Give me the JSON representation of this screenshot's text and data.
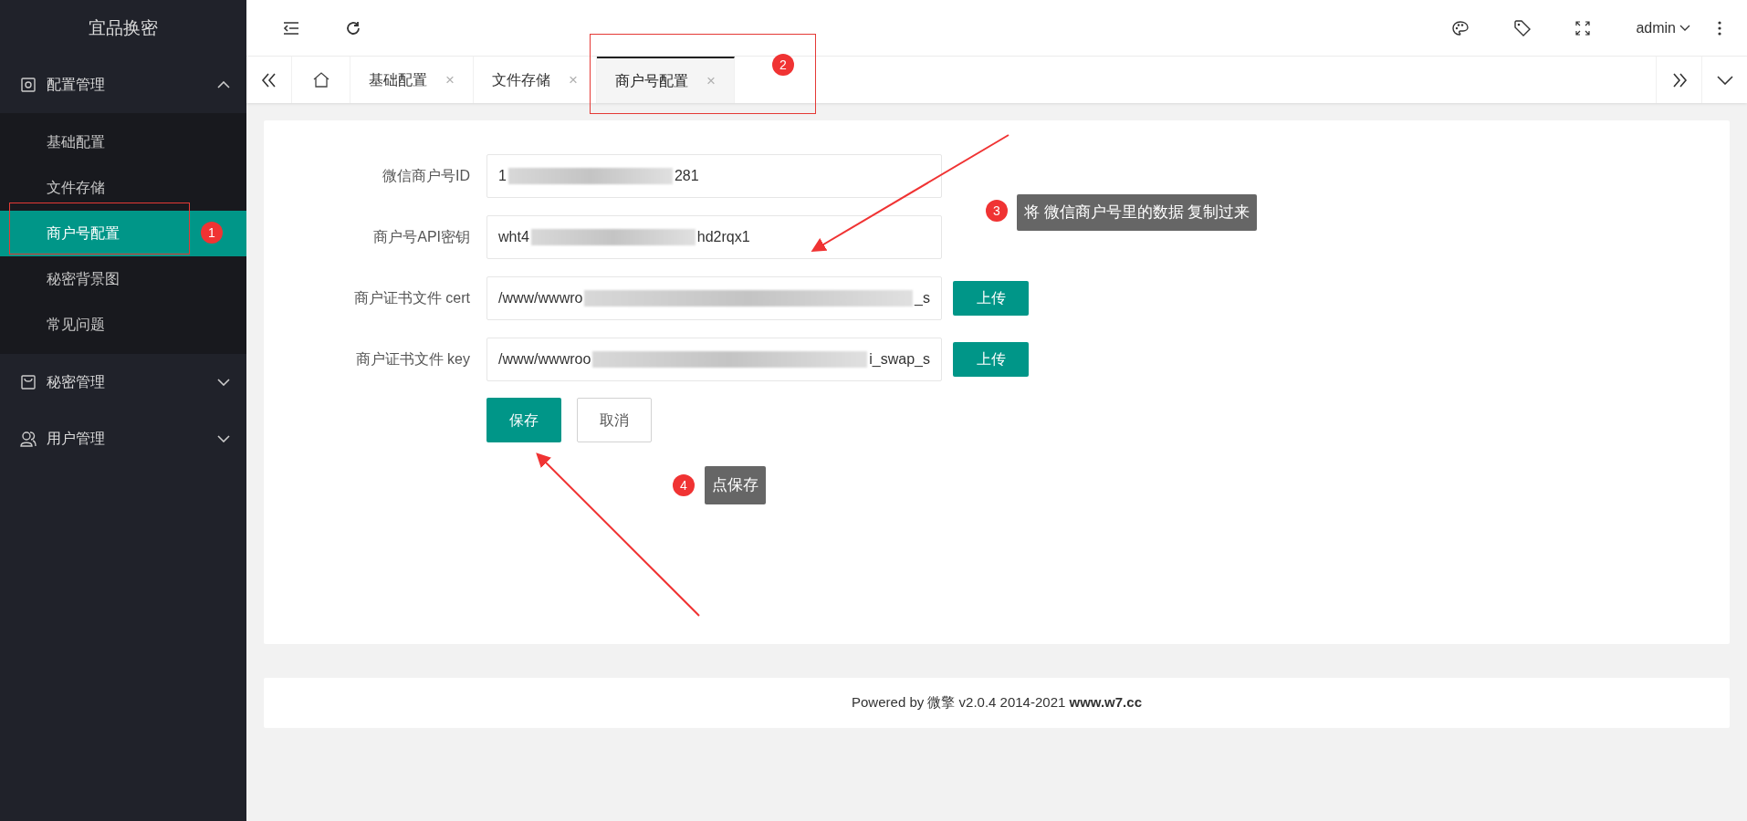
{
  "app_title": "宜品换密",
  "sidebar": [
    {
      "label": "配置管理",
      "expanded": true,
      "children": [
        {
          "label": "基础配置",
          "selected": false
        },
        {
          "label": "文件存储",
          "selected": false
        },
        {
          "label": "商户号配置",
          "selected": true
        },
        {
          "label": "秘密背景图",
          "selected": false
        },
        {
          "label": "常见问题",
          "selected": false
        }
      ]
    },
    {
      "label": "秘密管理",
      "expanded": false
    },
    {
      "label": "用户管理",
      "expanded": false
    }
  ],
  "user_menu": {
    "label": "admin"
  },
  "tabs": [
    {
      "kind": "home",
      "selected": false
    },
    {
      "kind": "page",
      "label": "基础配置",
      "close": "×",
      "selected": false
    },
    {
      "kind": "page",
      "label": "文件存储",
      "close": "×",
      "selected": false
    },
    {
      "kind": "page",
      "label": "商户号配置",
      "close": "×",
      "selected": true
    }
  ],
  "form": {
    "fields": [
      {
        "kind": "text",
        "label": "微信商户号ID",
        "value_start": "1",
        "value_end": "281"
      },
      {
        "kind": "text",
        "label": "商户号API密钥",
        "value_start": "wht4",
        "value_end": "hd2rqx1"
      },
      {
        "kind": "upload",
        "label": "商户证书文件 cert",
        "value_start": "/www/wwwro",
        "value_end": "_s",
        "upload_label": "上传"
      },
      {
        "kind": "upload",
        "label": "商户证书文件 key",
        "value_start": "/www/wwwroo",
        "value_end": "i_swap_s",
        "upload_label": "上传"
      }
    ],
    "buttons": [
      {
        "label": "保存",
        "kind": "primary"
      },
      {
        "label": "取消",
        "kind": "secondary"
      }
    ]
  },
  "annotations": [
    {
      "number": "1"
    },
    {
      "number": "2"
    },
    {
      "number": "3",
      "text": "将 微信商户号里的数据 复制过来"
    },
    {
      "number": "4",
      "text": "点保存"
    }
  ],
  "footer": "Powered by 微擎 v2.0.4 2014-2021 **www.w7.cc**"
}
